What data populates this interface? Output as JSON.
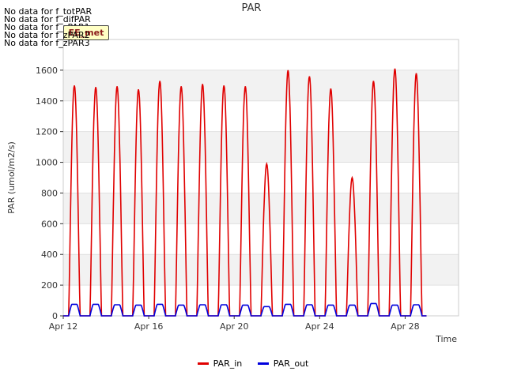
{
  "no_data_messages": [
    "No data for f_totPAR",
    "No data for f_difPAR",
    "No data for f_zPAR1",
    "No data for f_zPAR2",
    "No data for f_zPAR3"
  ],
  "badge_label": "EE_met",
  "legend": [
    {
      "label": "PAR_in",
      "color": "#e00000"
    },
    {
      "label": "PAR_out",
      "color": "#0000dd"
    }
  ],
  "chart_data": {
    "type": "line",
    "title": "PAR",
    "xlabel": "Time",
    "ylabel": "PAR (umol/m2/s)",
    "xlim": [
      "2016-04-12",
      "2016-04-30"
    ],
    "ylim": [
      0,
      1800
    ],
    "grid": true,
    "legend_position": "bottom-center",
    "xticks": [
      "Apr 12",
      "Apr 16",
      "Apr 20",
      "Apr 24",
      "Apr 28"
    ],
    "yticks": [
      0,
      200,
      400,
      600,
      800,
      1000,
      1200,
      1400,
      1600
    ],
    "daily_peaks": {
      "dates": [
        "Apr 12",
        "Apr 13",
        "Apr 14",
        "Apr 15",
        "Apr 16",
        "Apr 17",
        "Apr 18",
        "Apr 19",
        "Apr 20",
        "Apr 21",
        "Apr 22",
        "Apr 23",
        "Apr 24",
        "Apr 25",
        "Apr 26",
        "Apr 27",
        "Apr 28"
      ],
      "PAR_in": [
        1500,
        1490,
        1495,
        1475,
        1530,
        1495,
        1510,
        1500,
        1495,
        990,
        1600,
        1560,
        1480,
        900,
        1530,
        1610,
        1580
      ],
      "PAR_out": [
        75,
        75,
        72,
        70,
        75,
        70,
        72,
        72,
        70,
        60,
        75,
        72,
        70,
        70,
        80,
        70,
        72
      ]
    },
    "series": [
      {
        "name": "PAR_in",
        "color": "#e00000"
      },
      {
        "name": "PAR_out",
        "color": "#0000dd"
      }
    ]
  }
}
